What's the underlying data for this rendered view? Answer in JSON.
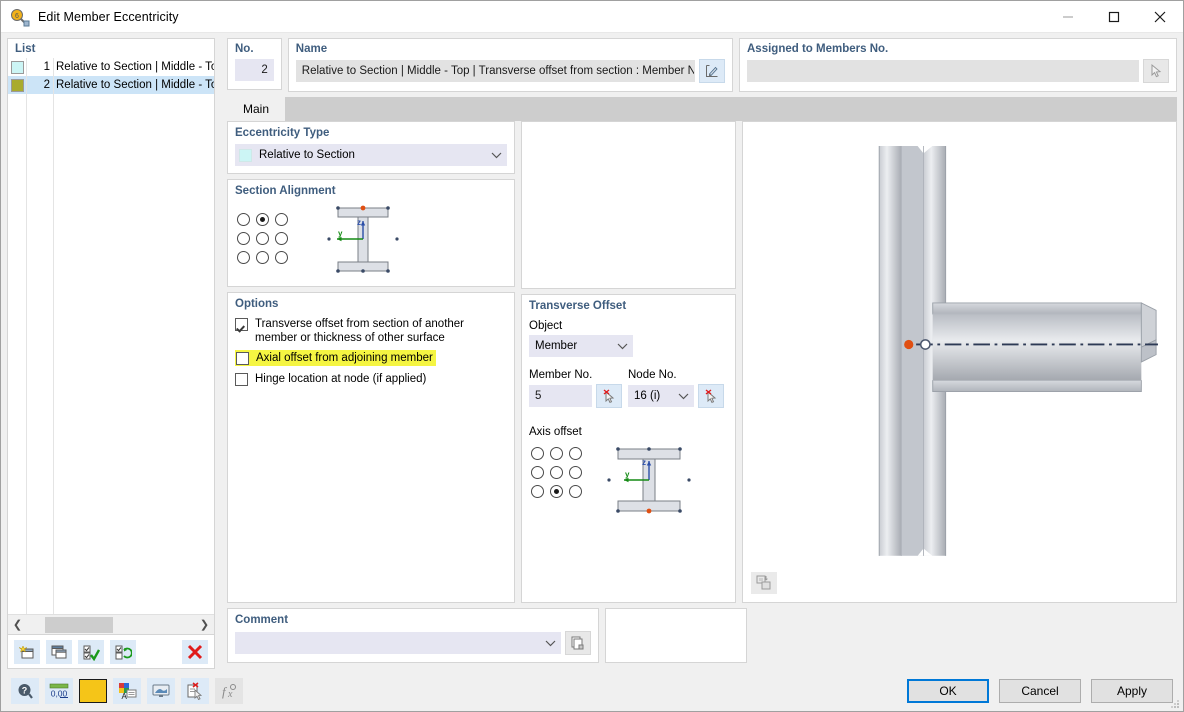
{
  "window": {
    "title": "Edit Member Eccentricity",
    "icon": "eccentricity-app-icon",
    "minimize_label": "Minimize",
    "maximize_label": "Maximize",
    "close_label": "Close"
  },
  "left": {
    "group_label": "List",
    "rows": [
      {
        "no": "1",
        "text": "Relative to Section | Middle - To",
        "color": "#ccf5f5",
        "selected": false
      },
      {
        "no": "2",
        "text": "Relative to Section | Middle - To",
        "color": "#a9ab2e",
        "selected": true
      }
    ],
    "scroll_left_icon": "chevron-left-icon",
    "scroll_right_icon": "chevron-right-icon",
    "toolbar": [
      {
        "name": "new-eccentricity-button",
        "icon": "new-item-icon"
      },
      {
        "name": "copy-eccentricity-button",
        "icon": "copy-item-icon"
      },
      {
        "name": "select-all-button",
        "icon": "check-all-icon"
      },
      {
        "name": "refresh-selection-button",
        "icon": "refresh-check-icon"
      },
      {
        "name": "delete-eccentricity-button",
        "icon": "delete-x-icon"
      }
    ]
  },
  "header": {
    "no_label": "No.",
    "no_value": "2",
    "name_label": "Name",
    "name_value": "Relative to Section | Middle - Top | Transverse offset from section : Member No",
    "name_edit_icon": "edit-pencil-icon",
    "assigned_label": "Assigned to Members No.",
    "assigned_value": "",
    "assigned_pick_icon": "pick-cursor-icon"
  },
  "tabs": [
    {
      "label": "Main",
      "active": true
    }
  ],
  "eccentricity_type": {
    "title": "Eccentricity Type",
    "value": "Relative to Section",
    "swatch_color": "#ccf5f5",
    "chevron_icon": "chevron-down-icon"
  },
  "section_alignment": {
    "title": "Section Alignment",
    "grid": [
      [
        false,
        true,
        false
      ],
      [
        false,
        false,
        false
      ],
      [
        false,
        false,
        false
      ]
    ],
    "figure_name": "i-section-alignment-figure",
    "axis_labels": {
      "z": "z",
      "y": "y"
    }
  },
  "options": {
    "title": "Options",
    "items": [
      {
        "label": "Transverse offset from section of another member or thickness of other surface",
        "checked": true,
        "highlighted": false,
        "name": "option-transverse-offset"
      },
      {
        "label": "Axial offset from adjoining member",
        "checked": false,
        "highlighted": true,
        "name": "option-axial-offset"
      },
      {
        "label": "Hinge location at node (if applied)",
        "checked": false,
        "highlighted": false,
        "name": "option-hinge-location"
      }
    ],
    "highlight_color": "#f5f542"
  },
  "transverse_offset": {
    "title": "Transverse Offset",
    "object_label": "Object",
    "object_value": "Member",
    "object_chevron_icon": "chevron-down-icon",
    "member_label": "Member No.",
    "member_value": "5",
    "member_pick_icon": "pick-cursor-icon",
    "node_label": "Node No.",
    "node_value": "16 (i)",
    "node_chevron_icon": "chevron-down-icon",
    "node_pick_icon": "pick-cursor-icon",
    "axis_offset_label": "Axis offset",
    "axis_grid": [
      [
        false,
        false,
        false
      ],
      [
        false,
        false,
        false
      ],
      [
        false,
        true,
        false
      ]
    ],
    "figure_name": "i-section-axis-offset-figure",
    "axis_labels": {
      "z": "z",
      "y": "y"
    }
  },
  "comment": {
    "title": "Comment",
    "value": "",
    "chevron_icon": "chevron-down-icon",
    "copy_icon": "copy-pages-icon"
  },
  "preview": {
    "name": "member-eccentricity-3d-preview",
    "description": "Beam-to-column connection showing transverse offset",
    "toggle_icon": "view-layers-icon"
  },
  "footer": {
    "tools": [
      {
        "name": "help-button",
        "icon": "help-question-icon"
      },
      {
        "name": "decimal-places-button",
        "icon": "decimal-0-00-icon"
      },
      {
        "name": "color-swatch-button",
        "icon": "color-swatch-icon",
        "color": "#f5c518"
      },
      {
        "name": "font-settings-button",
        "icon": "font-color-icon"
      },
      {
        "name": "display-settings-button",
        "icon": "display-monitor-icon"
      },
      {
        "name": "clear-selection-button",
        "icon": "clear-pick-icon"
      },
      {
        "name": "formula-button",
        "icon": "fx-formula-icon"
      }
    ],
    "ok_label": "OK",
    "cancel_label": "Cancel",
    "apply_label": "Apply"
  }
}
